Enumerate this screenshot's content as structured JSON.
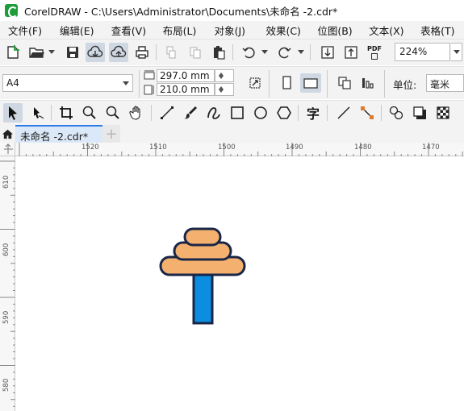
{
  "window": {
    "title": "CorelDRAW - C:\\Users\\Administrator\\Documents\\未命名 -2.cdr*"
  },
  "menu": [
    {
      "label": "文件(F)"
    },
    {
      "label": "编辑(E)"
    },
    {
      "label": "查看(V)"
    },
    {
      "label": "布局(L)"
    },
    {
      "label": "对象(J)"
    },
    {
      "label": "效果(C)"
    },
    {
      "label": "位图(B)"
    },
    {
      "label": "文本(X)"
    },
    {
      "label": "表格(T)"
    }
  ],
  "standard_toolbar": {
    "buttons": [
      "new-document-icon",
      "open-folder-icon",
      "save-icon",
      "cloud-download-icon",
      "cloud-upload-icon",
      "print-icon",
      "cut-icon",
      "copy-icon",
      "paste-icon",
      "undo-icon",
      "redo-icon",
      "import-icon",
      "export-icon",
      "export-pdf-icon"
    ],
    "pdf_label": "PDF",
    "zoom": "224%"
  },
  "property_bar": {
    "page_size": "A4",
    "width": "297.0 mm",
    "height": "210.0 mm",
    "unit_label": "单位:",
    "unit_value": "毫米"
  },
  "toolbox": [
    "pick-tool-icon",
    "freehand-pick-icon",
    "crop-tool-icon",
    "zoom-tool-icon",
    "zoom-out-icon",
    "pan-hand-icon",
    "curve-tool-icon",
    "artistic-media-icon",
    "smart-draw-icon",
    "rectangle-tool-icon",
    "ellipse-tool-icon",
    "polygon-tool-icon",
    "text-tool-icon",
    "connector-line-icon",
    "shape-edit-icon",
    "transparency-icon",
    "drop-shadow-icon",
    "checkerboard-icon"
  ],
  "text_tool_glyph": "字",
  "tabs": {
    "active": "未命名 -2.cdr*",
    "add": "+"
  },
  "ruler": {
    "horizontal": [
      "1520",
      "1510",
      "1500",
      "1490",
      "1480",
      "1470"
    ],
    "vertical": [
      "610",
      "600",
      "590",
      "580"
    ]
  },
  "artwork": {
    "fill_tan": "#f4b06e",
    "fill_blue": "#0b8ee0",
    "stroke": "#1a2647"
  }
}
